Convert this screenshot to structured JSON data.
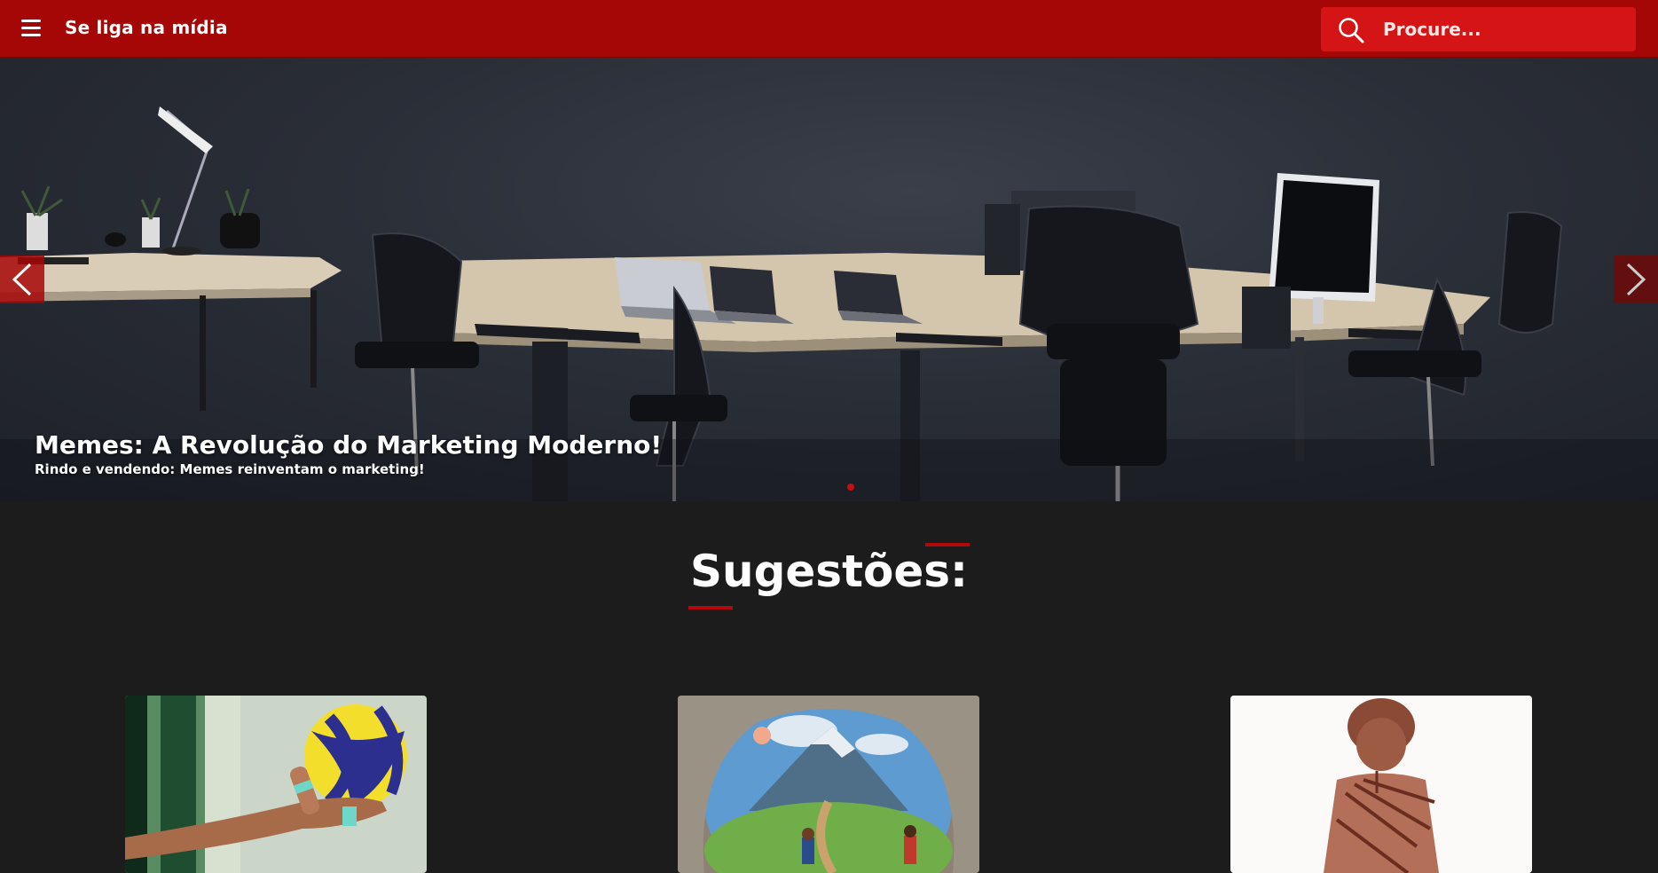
{
  "header": {
    "brand": "Se liga na mídia",
    "menu_icon": "hamburger-icon",
    "search_icon": "search-icon",
    "search_placeholder": "Procure...",
    "background_color": "#a50606",
    "search_color": "#d51515"
  },
  "hero": {
    "title": "Memes: A Revolução do Marketing Moderno!",
    "subtitle": "Rindo e vendendo: Memes reinventam o marketing!",
    "prev_icon": "chevron-left-icon",
    "next_icon": "chevron-right-icon",
    "dot_color": "#c41010"
  },
  "suggestions": {
    "title": "Sugestões:",
    "accent_color": "#b20a0a",
    "cards": [
      {
        "image": "volleyball-hand-photo"
      },
      {
        "image": "cave-mountain-children-illustration"
      },
      {
        "image": "vintage-engraving-portrait"
      }
    ]
  }
}
